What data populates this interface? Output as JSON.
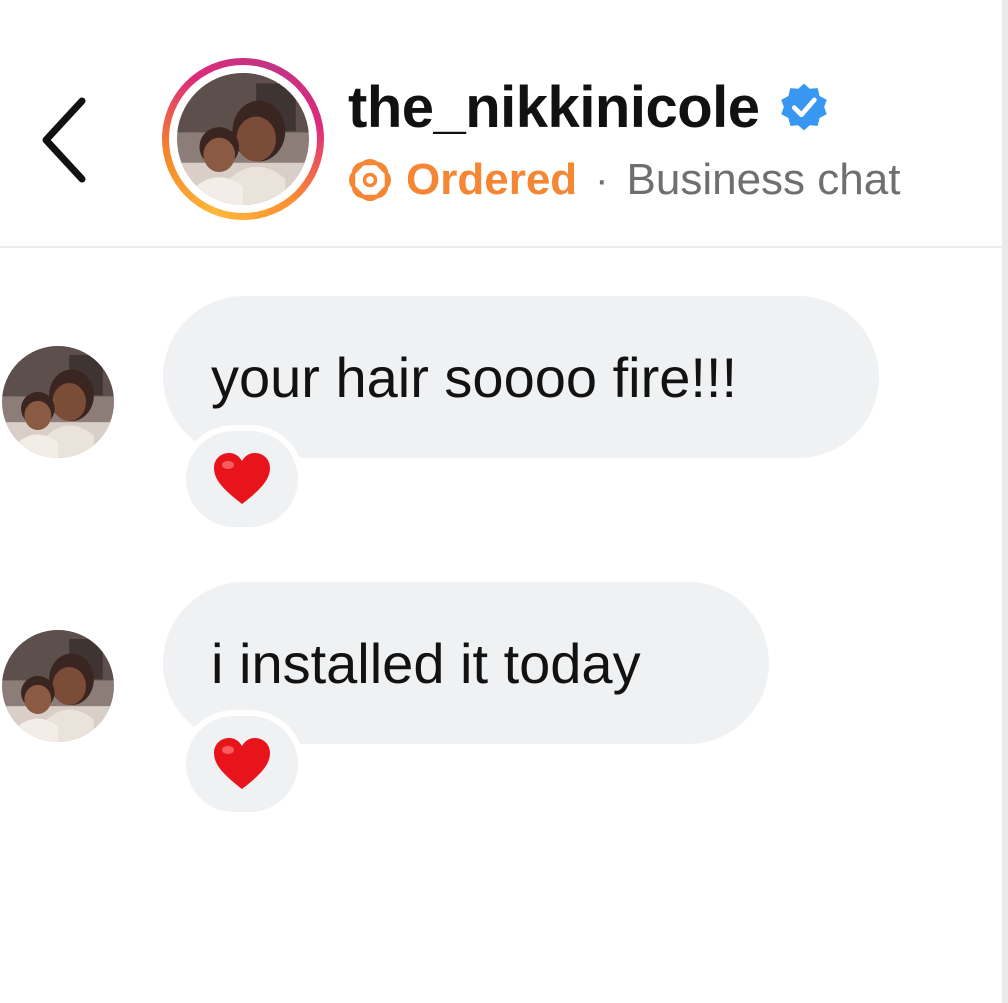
{
  "header": {
    "back_icon": "chevron-left-icon",
    "username": "the_nikkinicole",
    "verified_icon": "verified-badge-icon",
    "order_icon": "order-status-icon",
    "status": "Ordered",
    "separator": "·",
    "chat_type": "Business chat",
    "colors": {
      "status": "#f58634",
      "verified": "#3897f0"
    }
  },
  "messages": [
    {
      "text": "your hair soooo fire!!!",
      "reaction": "red-heart"
    },
    {
      "text": "i installed it today",
      "reaction": "red-heart"
    }
  ]
}
